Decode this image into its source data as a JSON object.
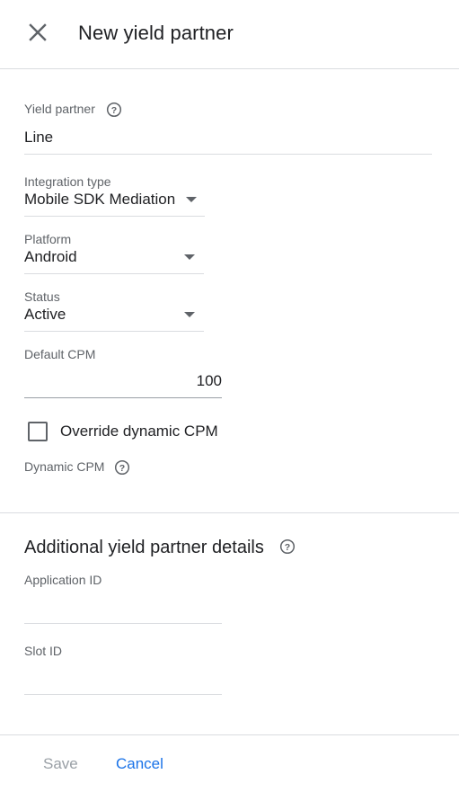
{
  "header": {
    "title": "New yield partner",
    "close_icon": "close-icon"
  },
  "form": {
    "yield_partner": {
      "label": "Yield partner",
      "value": "Line"
    },
    "integration_type": {
      "label": "Integration type",
      "value": "Mobile SDK Mediation"
    },
    "platform": {
      "label": "Platform",
      "value": "Android"
    },
    "status": {
      "label": "Status",
      "value": "Active"
    },
    "default_cpm": {
      "label": "Default CPM",
      "value": "100"
    },
    "override_dynamic_cpm": {
      "label": "Override dynamic CPM",
      "checked": false
    },
    "dynamic_cpm": {
      "label": "Dynamic CPM"
    }
  },
  "additional": {
    "title": "Additional yield partner details",
    "application_id": {
      "label": "Application ID",
      "value": ""
    },
    "slot_id": {
      "label": "Slot ID",
      "value": ""
    }
  },
  "footer": {
    "save_label": "Save",
    "cancel_label": "Cancel"
  },
  "colors": {
    "accent": "#1a73e8",
    "disabled": "#9aa0a6",
    "border": "#dadce0",
    "label": "#5f6368"
  }
}
